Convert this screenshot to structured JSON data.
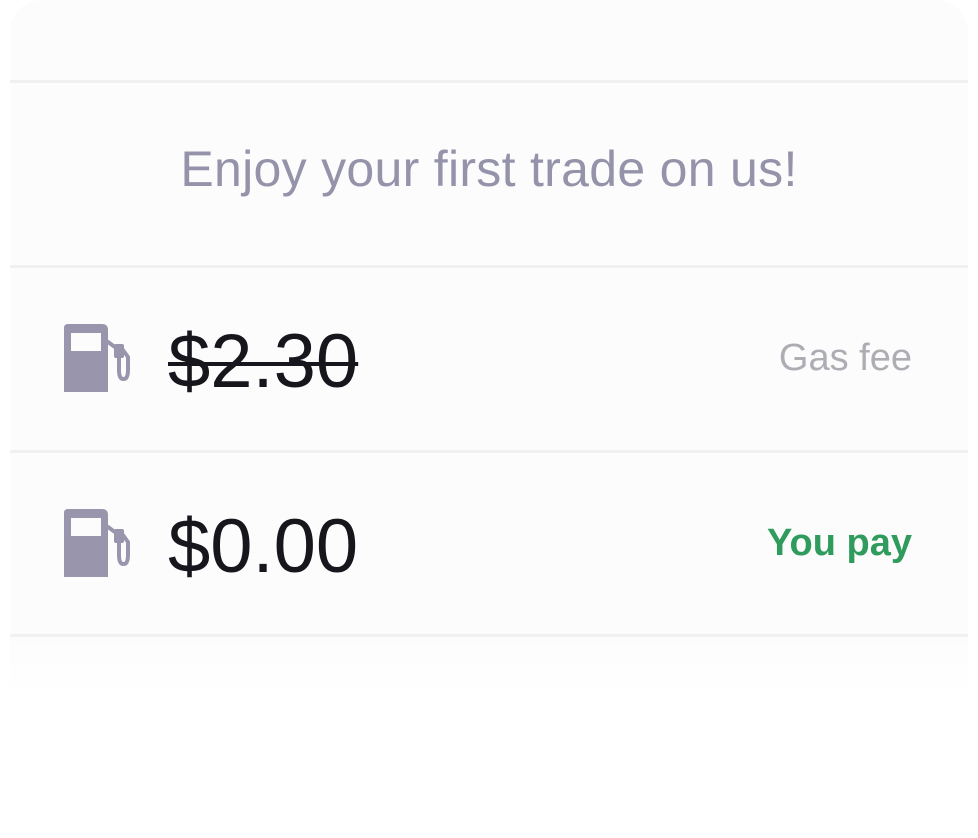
{
  "promo": {
    "headline": "Enjoy your first trade on us!"
  },
  "fees": [
    {
      "icon": "fuel-pump-icon",
      "amount": "$2.30",
      "label": "Gas fee",
      "struck": true
    },
    {
      "icon": "fuel-pump-icon",
      "amount": "$0.00",
      "label": "You pay",
      "struck": false
    }
  ],
  "colors": {
    "headline": "#9593aa",
    "icon": "#9895ac",
    "amount": "#17161d",
    "muted_label": "#aeadb3",
    "positive_label": "#2f9b5c"
  }
}
